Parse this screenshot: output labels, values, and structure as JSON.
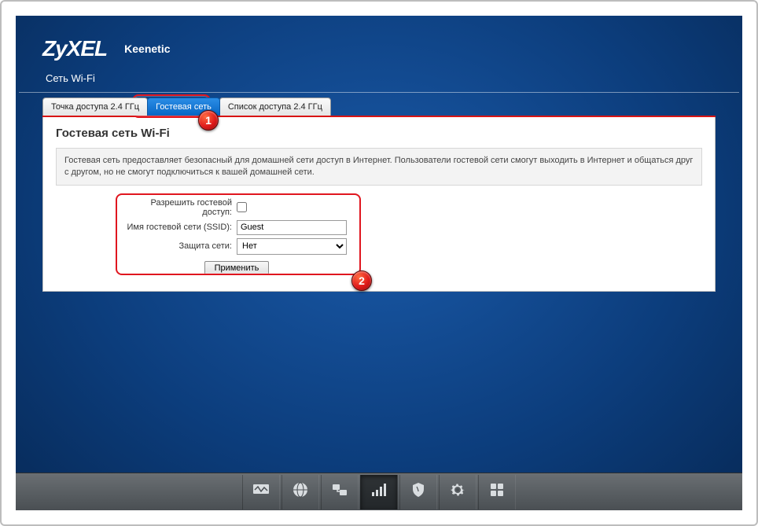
{
  "brand": {
    "logo": "ZyXEL",
    "product": "Keenetic"
  },
  "section_title": "Сеть Wi-Fi",
  "tabs": [
    {
      "label": "Точка доступа 2.4 ГГц"
    },
    {
      "label": "Гостевая сеть"
    },
    {
      "label": "Список доступа 2.4 ГГц"
    }
  ],
  "panel": {
    "title": "Гостевая сеть Wi-Fi",
    "info": "Гостевая сеть предоставляет безопасный для домашней сети доступ в Интернет. Пользователи гостевой сети смогут выходить в Интернет и общаться друг с другом, но не смогут подключиться к вашей домашней сети."
  },
  "form": {
    "allow_label": "Разрешить гостевой доступ:",
    "ssid_label": "Имя гостевой сети (SSID):",
    "ssid_value": "Guest",
    "security_label": "Защита сети:",
    "security_value": "Нет",
    "apply_label": "Применить"
  },
  "markers": {
    "one": "1",
    "two": "2"
  },
  "toolbar": {
    "items": [
      {
        "name": "monitor-icon"
      },
      {
        "name": "globe-icon"
      },
      {
        "name": "network-icon"
      },
      {
        "name": "wifi-bars-icon",
        "active": true
      },
      {
        "name": "shield-icon"
      },
      {
        "name": "gear-icon"
      },
      {
        "name": "apps-icon"
      }
    ]
  }
}
